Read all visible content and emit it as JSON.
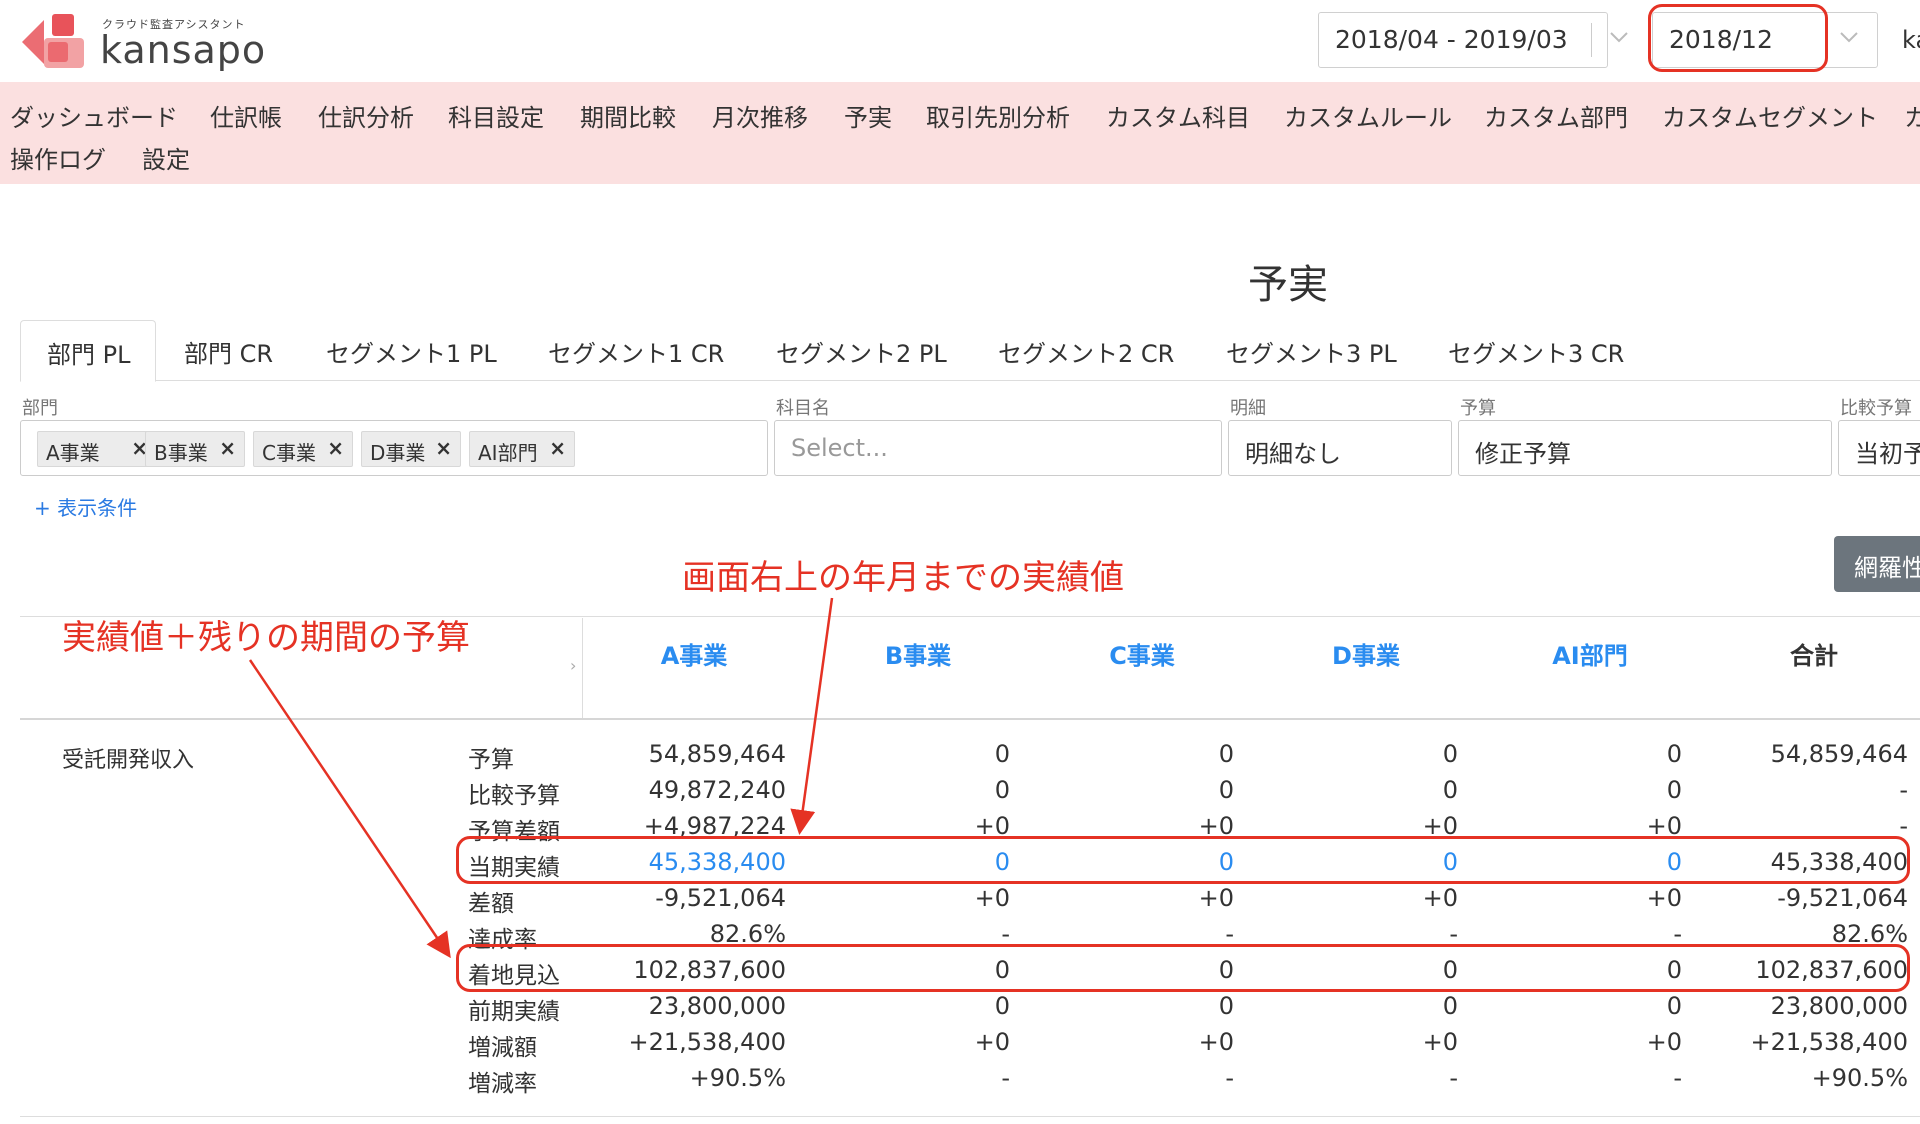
{
  "app": {
    "logo_subtitle": "クラウド監査アシスタント",
    "logo_name": "kansapo",
    "user_fragment": "ka",
    "colors": {
      "accent": "#2a8cf0",
      "nav_bg": "#fbe0e0",
      "annotation": "#e53224"
    }
  },
  "header": {
    "period_select": "2018/04 - 2019/03",
    "month_select": "2018/12"
  },
  "nav": {
    "items": [
      "ダッシュボード",
      "仕訳帳",
      "仕訳分析",
      "科目設定",
      "期間比較",
      "月次推移",
      "予実",
      "取引先別分析",
      "カスタム科目",
      "カスタムルール",
      "カスタム部門",
      "カスタムセグメント",
      "カ",
      "操作ログ",
      "設定"
    ]
  },
  "page": {
    "title": "予実"
  },
  "tabs": [
    "部門 PL",
    "部門 CR",
    "セグメント1 PL",
    "セグメント1 CR",
    "セグメント2 PL",
    "セグメント2 CR",
    "セグメント3 PL",
    "セグメント3 CR"
  ],
  "filters": {
    "dept_label": "部門",
    "dept_chips": [
      "A事業",
      "B事業",
      "C事業",
      "D事業",
      "AI部門"
    ],
    "account_label": "科目名",
    "account_placeholder": "Select...",
    "detail_label": "明細",
    "detail_value": "明細なし",
    "budget_label": "予算",
    "budget_value": "修正予算",
    "compare_label": "比較予算",
    "compare_value": "当初予",
    "add_condition": "+ 表示条件",
    "right_button": "網羅性"
  },
  "table": {
    "columns": [
      "A事業",
      "B事業",
      "C事業",
      "D事業",
      "AI部門",
      "合計"
    ],
    "account": "受託開発収入",
    "rows": [
      {
        "label": "予算",
        "values": [
          "54,859,464",
          "0",
          "0",
          "0",
          "0",
          "54,859,464"
        ]
      },
      {
        "label": "比較予算",
        "values": [
          "49,872,240",
          "0",
          "0",
          "0",
          "0",
          "-"
        ]
      },
      {
        "label": "予算差額",
        "values": [
          "+4,987,224",
          "+0",
          "+0",
          "+0",
          "+0",
          "-"
        ]
      },
      {
        "label": "当期実績",
        "values": [
          "45,338,400",
          "0",
          "0",
          "0",
          "0",
          "45,338,400"
        ]
      },
      {
        "label": "差額",
        "values": [
          "-9,521,064",
          "+0",
          "+0",
          "+0",
          "+0",
          "-9,521,064"
        ]
      },
      {
        "label": "達成率",
        "values": [
          "82.6%",
          "-",
          "-",
          "-",
          "-",
          "82.6%"
        ]
      },
      {
        "label": "着地見込",
        "values": [
          "102,837,600",
          "0",
          "0",
          "0",
          "0",
          "102,837,600"
        ]
      },
      {
        "label": "前期実績",
        "values": [
          "23,800,000",
          "0",
          "0",
          "0",
          "0",
          "23,800,000"
        ]
      },
      {
        "label": "増減額",
        "values": [
          "+21,538,400",
          "+0",
          "+0",
          "+0",
          "+0",
          "+21,538,400"
        ]
      },
      {
        "label": "増減率",
        "values": [
          "+90.5%",
          "-",
          "-",
          "-",
          "-",
          "+90.5%"
        ]
      }
    ]
  },
  "annotations": {
    "top": "画面右上の年月までの実績値",
    "left": "実績値＋残りの期間の予算"
  }
}
